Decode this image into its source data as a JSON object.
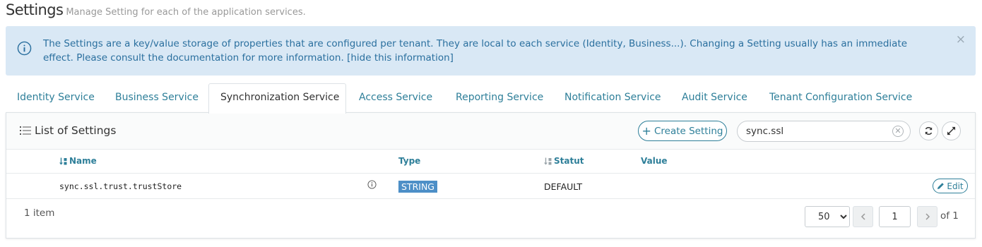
{
  "page": {
    "title": "Settings",
    "subtitle": "Manage Setting for each of the application services."
  },
  "info_banner": {
    "text": "The Settings are a key/value storage of properties that are configured per tenant. They are local to each service (Identity, Business...). Changing a Setting usually has an immediate effect. Please consult the documentation for more information.",
    "link_label": "[hide this information]",
    "close_label": "×"
  },
  "tabs": [
    {
      "label": "Identity Service",
      "active": false
    },
    {
      "label": "Business Service",
      "active": false
    },
    {
      "label": "Synchronization Service",
      "active": true
    },
    {
      "label": "Access Service",
      "active": false
    },
    {
      "label": "Reporting Service",
      "active": false
    },
    {
      "label": "Notification Service",
      "active": false
    },
    {
      "label": "Audit Service",
      "active": false
    },
    {
      "label": "Tenant Configuration Service",
      "active": false
    }
  ],
  "panel": {
    "title": "List of Settings",
    "create_label": "Create Setting",
    "search_value": "sync.ssl"
  },
  "table": {
    "columns": [
      "Name",
      "Type",
      "Statut",
      "Value"
    ],
    "rows": [
      {
        "name": "sync.ssl.trust.trustStore",
        "type": "STRING",
        "status": "DEFAULT",
        "value": "",
        "edit_label": "Edit"
      }
    ]
  },
  "footer": {
    "count": "1 item",
    "page_size": "50",
    "page_size_options": [
      "50"
    ],
    "current_page": "1",
    "of_label": "of 1"
  },
  "colors": {
    "accent": "#2e7f99",
    "banner_bg": "#d9e8f5",
    "badge_bg": "#4d8fc7"
  }
}
